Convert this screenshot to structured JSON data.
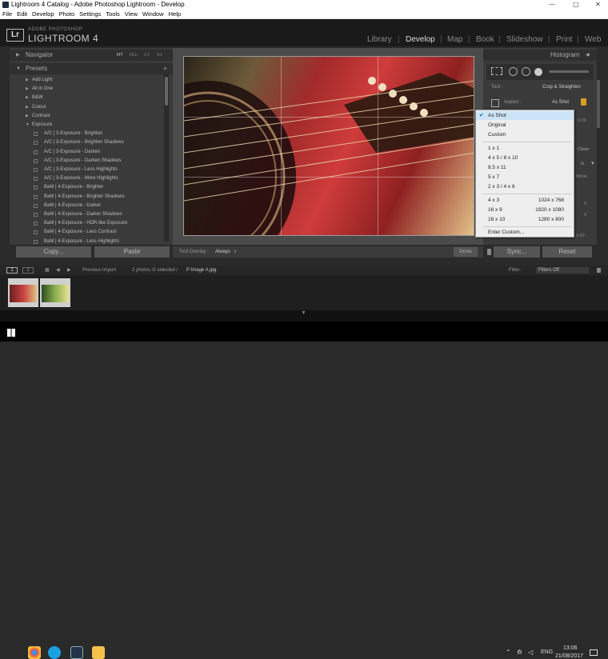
{
  "window": {
    "title": "Lightroom 4 Catalog - Adobe Photoshop Lightroom - Develop",
    "min": "—",
    "max": "▢",
    "close": "✕"
  },
  "menu": [
    "File",
    "Edit",
    "Develop",
    "Photo",
    "Settings",
    "Tools",
    "View",
    "Window",
    "Help"
  ],
  "brand": {
    "logo": "Lr",
    "line1": "ADOBE PHOTOSHOP",
    "line2": "LIGHTROOM 4"
  },
  "modules": [
    "Library",
    "Develop",
    "Map",
    "Book",
    "Slideshow",
    "Print",
    "Web"
  ],
  "active_module": "Develop",
  "navigator": {
    "title": "Navigator",
    "zooms": [
      "FIT",
      "FILL",
      "1:1",
      "3:1"
    ]
  },
  "presets": {
    "title": "Presets",
    "add": "+",
    "folders": [
      "Add Light",
      "All in One",
      "B&W",
      "Colour",
      "Contrast",
      "Exposure"
    ],
    "items": [
      "A/C | 3-Exposure - Brighten",
      "A/C | 3-Exposure - Brighten Shadows",
      "A/C | 3-Exposure - Darken",
      "A/C | 3-Exposure - Darken Shadows",
      "A/C | 3-Exposure - Less Highlights",
      "A/C | 3-Exposure - More Highlights",
      "BaM | 4-Exposure - Brighter",
      "BaM | 4-Exposure - Brighter Shadows",
      "BaM | 4-Exposure - Darker",
      "BaM | 4-Exposure - Darker Shadows",
      "BaM | 4-Exposure - HDR-like Exposure",
      "BaM | 4-Exposure - Less Contrast",
      "BaM | 4-Exposure - Less Highlights"
    ]
  },
  "left_buttons": {
    "copy": "Copy...",
    "paste": "Paste"
  },
  "toolbar": {
    "overlay_label": "Tool Overlay :",
    "overlay_value": "Always",
    "done": "Done"
  },
  "histogram": {
    "title": "Histogram"
  },
  "crop": {
    "tool_label": "Tool :",
    "tool_value": "Crop & Straighten",
    "aspect_label": "Aspect :",
    "aspect_value": "As Shot",
    "value_1": "0.00",
    "close": "Close",
    "mode_1": "ic",
    "mode_2": "White",
    "zero_1": "0",
    "zero_2": "0",
    "value_2": "0.00"
  },
  "right_buttons": {
    "sync": "Sync...",
    "reset": "Reset"
  },
  "dropdown": {
    "group1": [
      "As Shot",
      "Original",
      "Custom"
    ],
    "group2": [
      "1 x 1",
      "4 x 5  /  8 x 10",
      "8.5 x 11",
      "5 x 7",
      "2 x 3  /  4 x 6"
    ],
    "group3": [
      {
        "label": "4 x 3",
        "res": "1024 x 768"
      },
      {
        "label": "16 x 9",
        "res": "1920 x 1080"
      },
      {
        "label": "16 x 10",
        "res": "1280 x 800"
      }
    ],
    "group4": [
      "Enter Custom..."
    ],
    "selected": "As Shot"
  },
  "filmbar": {
    "page1": "1",
    "page2": "2",
    "prev": "Previous Import",
    "info": "2 photos /2 selected /",
    "file": "P Image A.jpg",
    "filter_label": "Filter :",
    "filter_value": "Filters Off"
  },
  "taskbar": {
    "time": "13:06",
    "date": "21/08/2017",
    "lang": "ENG"
  }
}
